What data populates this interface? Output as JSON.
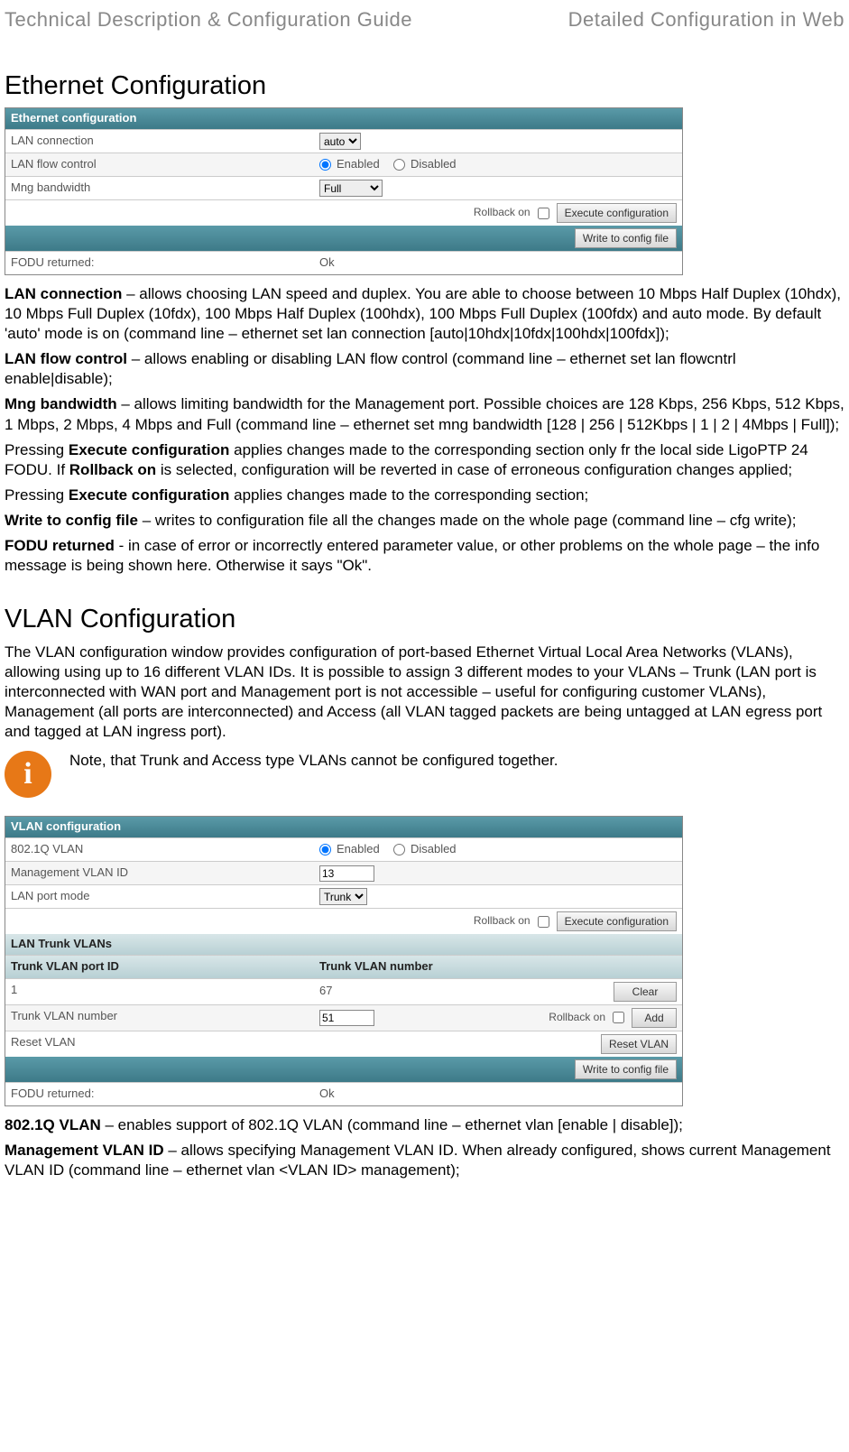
{
  "header": {
    "left": "Technical Description & Configuration Guide",
    "right": "Detailed Configuration in Web"
  },
  "sec1": {
    "title": "Ethernet Configuration",
    "panel": {
      "head": "Ethernet configuration",
      "r1_label": "LAN connection",
      "r1_sel": "auto",
      "r2_label": "LAN flow control",
      "r2_enabled": "Enabled",
      "r2_disabled": "Disabled",
      "r3_label": "Mng bandwidth",
      "r3_sel": "Full",
      "rollback": "Rollback on",
      "exec": "Execute configuration",
      "write": "Write to config file",
      "fodu_label": "FODU returned:",
      "fodu_val": "Ok"
    },
    "p1_b": "LAN connection",
    "p1": " – allows choosing LAN speed and duplex. You are able to choose between 10 Mbps Half Duplex (10hdx), 10 Mbps Full Duplex (10fdx), 100 Mbps Half Duplex (100hdx), 100 Mbps Full Duplex (100fdx) and auto mode. By default 'auto' mode is on (command line – ethernet set lan connection [auto|10hdx|10fdx|100hdx|100fdx]);",
    "p2_b": "LAN flow control",
    "p2": " – allows enabling or disabling LAN flow control (command line – ethernet set lan flowcntrl enable|disable);",
    "p3_b": "Mng bandwidth",
    "p3": " – allows limiting bandwidth for the Management port. Possible choices are 128 Kbps, 256 Kbps, 512 Kbps, 1 Mbps, 2 Mbps, 4 Mbps and Full (command line – ethernet set mng bandwidth [128 | 256 | 512Kbps | 1 | 2 | 4Mbps | Full]);",
    "p4a": "Pressing ",
    "p4b1": "Execute configuration",
    "p4c": " applies changes made to the corresponding section only fr the local side LigoPTP 24 FODU. If ",
    "p4b2": "Rollback on",
    "p4d": " is selected, configuration will be reverted in case of erroneous configuration changes applied;",
    "p5a": "Pressing ",
    "p5b": "Execute configuration",
    "p5c": " applies changes made to the corresponding section;",
    "p6_b": "Write to config file",
    "p6": " – writes to configuration file all the changes made on the whole page (command line – cfg write);",
    "p7_b": "FODU returned",
    "p7": " - in case of error or incorrectly entered parameter value, or other problems on the whole page – the info message is being shown here. Otherwise it says \"Ok\"."
  },
  "sec2": {
    "title": "VLAN Configuration",
    "intro": "The VLAN configuration window provides configuration of port-based Ethernet Virtual Local Area Networks (VLANs), allowing using up to 16 different VLAN IDs. It is possible to assign 3 different modes to your VLANs – Trunk (LAN port is interconnected with WAN port and Management port is not accessible – useful for configuring customer VLANs), Management (all ports are interconnected) and Access (all VLAN tagged packets are being untagged at LAN egress port and tagged at LAN ingress port).",
    "note": "Note, that Trunk and Access type VLANs cannot be configured together.",
    "panel": {
      "head": "VLAN configuration",
      "r1_label": "802.1Q VLAN",
      "enabled": "Enabled",
      "disabled": "Disabled",
      "r2_label": "Management VLAN ID",
      "r2_val": "13",
      "r3_label": "LAN port mode",
      "r3_sel": "Trunk",
      "rollback": "Rollback on",
      "exec": "Execute configuration",
      "sub": "LAN Trunk VLANs",
      "col1": "Trunk VLAN port ID",
      "col2": "Trunk VLAN number",
      "row_id": "1",
      "row_num": "67",
      "clear": "Clear",
      "tvl_label": "Trunk VLAN number",
      "tvl_val": "51",
      "add": "Add",
      "reset_label": "Reset VLAN",
      "reset_btn": "Reset VLAN",
      "write": "Write to config file",
      "fodu_label": "FODU returned:",
      "fodu_val": "Ok"
    },
    "p1_b": "802.1Q VLAN",
    "p1": " – enables support of 802.1Q VLAN (command line – ethernet vlan [enable | disable]);",
    "p2_b": "Management VLAN ID",
    "p2": " – allows specifying Management VLAN ID. When already configured, shows current Management VLAN ID (command line – ethernet vlan <VLAN ID> management);"
  }
}
